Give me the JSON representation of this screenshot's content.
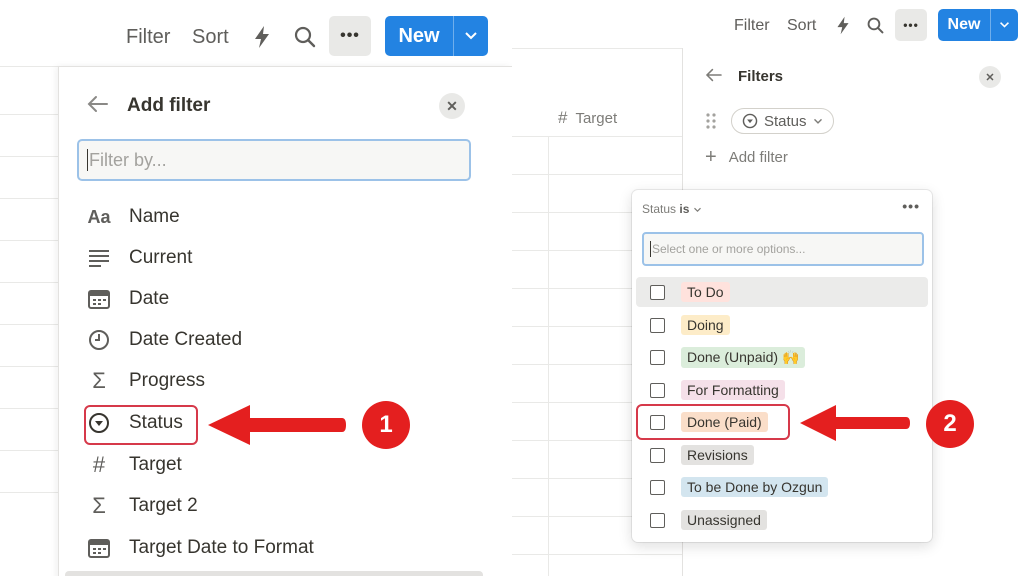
{
  "left": {
    "toolbar": {
      "filter_label": "Filter",
      "sort_label": "Sort",
      "more_label": "•••",
      "new_label": "New"
    },
    "popover": {
      "title": "Add filter",
      "search_placeholder": "Filter by...",
      "properties": [
        {
          "label": "Name",
          "icon": "Aa"
        },
        {
          "label": "Current",
          "icon": "≡"
        },
        {
          "label": "Date",
          "icon": "calendar"
        },
        {
          "label": "Date Created",
          "icon": "clock"
        },
        {
          "label": "Progress",
          "icon": "Σ"
        },
        {
          "label": "Status",
          "icon": "status"
        },
        {
          "label": "Target",
          "icon": "#"
        },
        {
          "label": "Target 2",
          "icon": "Σ"
        },
        {
          "label": "Target Date to Format",
          "icon": "calendar"
        }
      ]
    },
    "step_badge": "1"
  },
  "right": {
    "toolbar": {
      "filter_label": "Filter",
      "sort_label": "Sort",
      "more_label": "•••",
      "new_label": "New"
    },
    "column_header": "Target",
    "filters_panel": {
      "title": "Filters",
      "status_chip": "Status",
      "add_filter_label": "Add filter"
    },
    "dropdown": {
      "header_property": "Status",
      "header_operator": "is",
      "more_label": "•••",
      "search_placeholder": "Select one or more options...",
      "options": [
        {
          "label": "To Do",
          "color": "#ffe2dd"
        },
        {
          "label": "Doing",
          "color": "#fdecc8"
        },
        {
          "label": "Done (Unpaid) 🙌",
          "color": "#dbeddb"
        },
        {
          "label": "For Formatting",
          "color": "#f5e0e9"
        },
        {
          "label": "Done (Paid)",
          "color": "#fadec9"
        },
        {
          "label": "Revisions",
          "color": "#e3e2e0"
        },
        {
          "label": "To be Done by Ozgun",
          "color": "#d3e5ef"
        },
        {
          "label": "Unassigned",
          "color": "#e3e2e0"
        }
      ]
    },
    "step_badge": "2"
  },
  "accent_colors": {
    "new_button": "#2383e2",
    "callout": "#e41f1f",
    "focus_ring": "#9cc2e8"
  }
}
